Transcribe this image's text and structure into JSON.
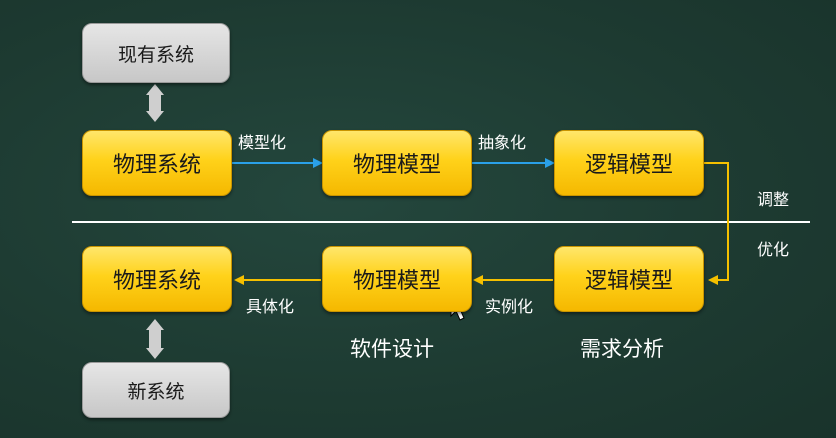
{
  "top": {
    "existing_system": "现有系统",
    "physical_system": "物理系统",
    "physical_model": "物理模型",
    "logical_model": "逻辑模型",
    "label_model_ize": "模型化",
    "label_abstract_ize": "抽象化"
  },
  "side": {
    "adjust": "调整",
    "optimize": "优化"
  },
  "bottom": {
    "physical_system": "物理系统",
    "physical_model": "物理模型",
    "logical_model": "逻辑模型",
    "label_concretize": "具体化",
    "label_instantiate": "实例化",
    "new_system": "新系统"
  },
  "captions": {
    "software_design": "软件设计",
    "requirements_analysis": "需求分析"
  },
  "colors": {
    "background": "#1e3b32",
    "box_yellow": "#ffd21a",
    "box_gray": "#cfcfcf",
    "arrow_blue": "#2aa0e8",
    "arrow_yellow": "#f5c000",
    "divider": "#ffffff"
  }
}
